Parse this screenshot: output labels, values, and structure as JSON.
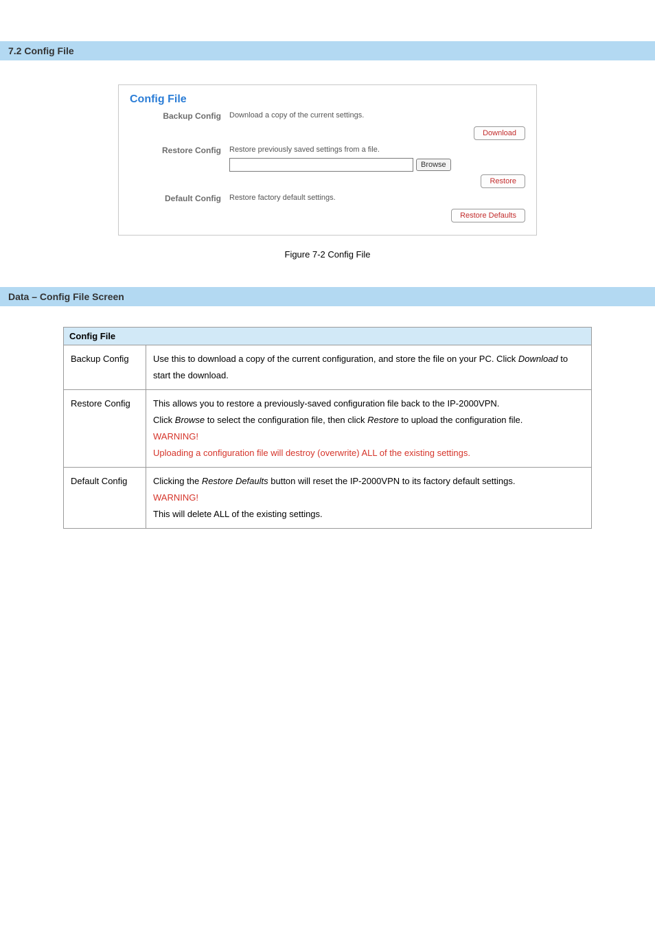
{
  "section1": {
    "bar": "7.2 Config File"
  },
  "panel": {
    "title": "Config File",
    "rows": {
      "backup": {
        "label": "Backup Config",
        "desc": "Download a copy of the current settings.",
        "button": "Download"
      },
      "restore": {
        "label": "Restore Config",
        "desc": "Restore previously saved settings from a file.",
        "browse": "Browse",
        "button": "Restore"
      },
      "defaults": {
        "label": "Default Config",
        "desc": "Restore factory default settings.",
        "button": "Restore Defaults"
      }
    }
  },
  "figure_caption": "Figure 7-2 Config File",
  "section2": {
    "bar": "Data – Config File Screen"
  },
  "table": {
    "header": "Config File",
    "rows": [
      {
        "label": "Backup Config",
        "body_parts": {
          "p1a": "Use this to download a copy of the current configuration, and store the file on your PC. Click ",
          "p1b": "Download",
          "p1c": " to start the download."
        }
      },
      {
        "label": "Restore Config",
        "body_parts": {
          "p1": "This allows you to restore a previously-saved configuration file back to the IP-2000VPN.",
          "p2a": "Click ",
          "p2b": "Browse",
          "p2c": " to select the configuration file, then click ",
          "p2d": "Restore",
          "p2e": " to upload the configuration file.",
          "warn": "WARNING!",
          "p3": "Uploading a configuration file will destroy (overwrite) ALL of the existing settings."
        }
      },
      {
        "label": "Default Config",
        "body_parts": {
          "p1a": "Clicking the ",
          "p1b": "Restore Defaults",
          "p1c": " button will reset the IP-2000VPN to its factory default settings.",
          "warn": "WARNING!",
          "p2": "This will delete ALL of the existing settings."
        }
      }
    ]
  }
}
